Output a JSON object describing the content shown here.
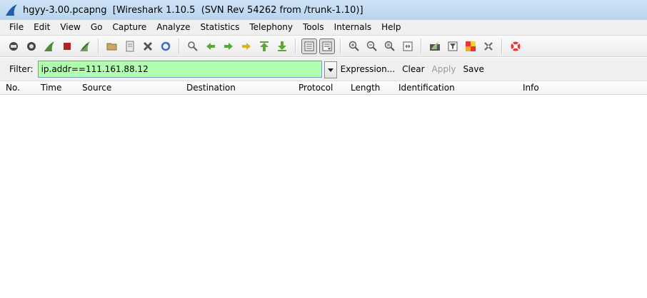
{
  "window": {
    "title": "hgyy-3.00.pcapng  [Wireshark 1.10.5  (SVN Rev 54262 from /trunk-1.10)]"
  },
  "menu": [
    "File",
    "Edit",
    "View",
    "Go",
    "Capture",
    "Analyze",
    "Statistics",
    "Telephony",
    "Tools",
    "Internals",
    "Help"
  ],
  "toolbar": {
    "icons": [
      "interface-list-icon",
      "capture-options-icon",
      "start-capture-icon",
      "stop-capture-icon",
      "restart-capture-icon",
      "open-file-icon",
      "save-file-icon",
      "close-file-icon",
      "reload-icon",
      "find-packet-icon",
      "go-back-icon",
      "go-forward-icon",
      "go-to-packet-icon",
      "go-first-icon",
      "go-last-icon",
      "colorize-icon",
      "auto-scroll-icon",
      "zoom-in-icon",
      "zoom-out-icon",
      "normal-size-icon",
      "resize-columns-icon",
      "capture-filters-icon",
      "display-filters-icon",
      "coloring-rules-icon",
      "preferences-icon",
      "help-icon"
    ]
  },
  "filter": {
    "label": "Filter:",
    "value": "ip.addr==111.161.88.12",
    "input_bg": "#afffaf",
    "expression_label": "Expression...",
    "clear_label": "Clear",
    "apply_label": "Apply",
    "save_label": "Save"
  },
  "columns": [
    "No.",
    "Time",
    "Source",
    "Destination",
    "Protocol",
    "Length",
    "Identification",
    "Info"
  ]
}
